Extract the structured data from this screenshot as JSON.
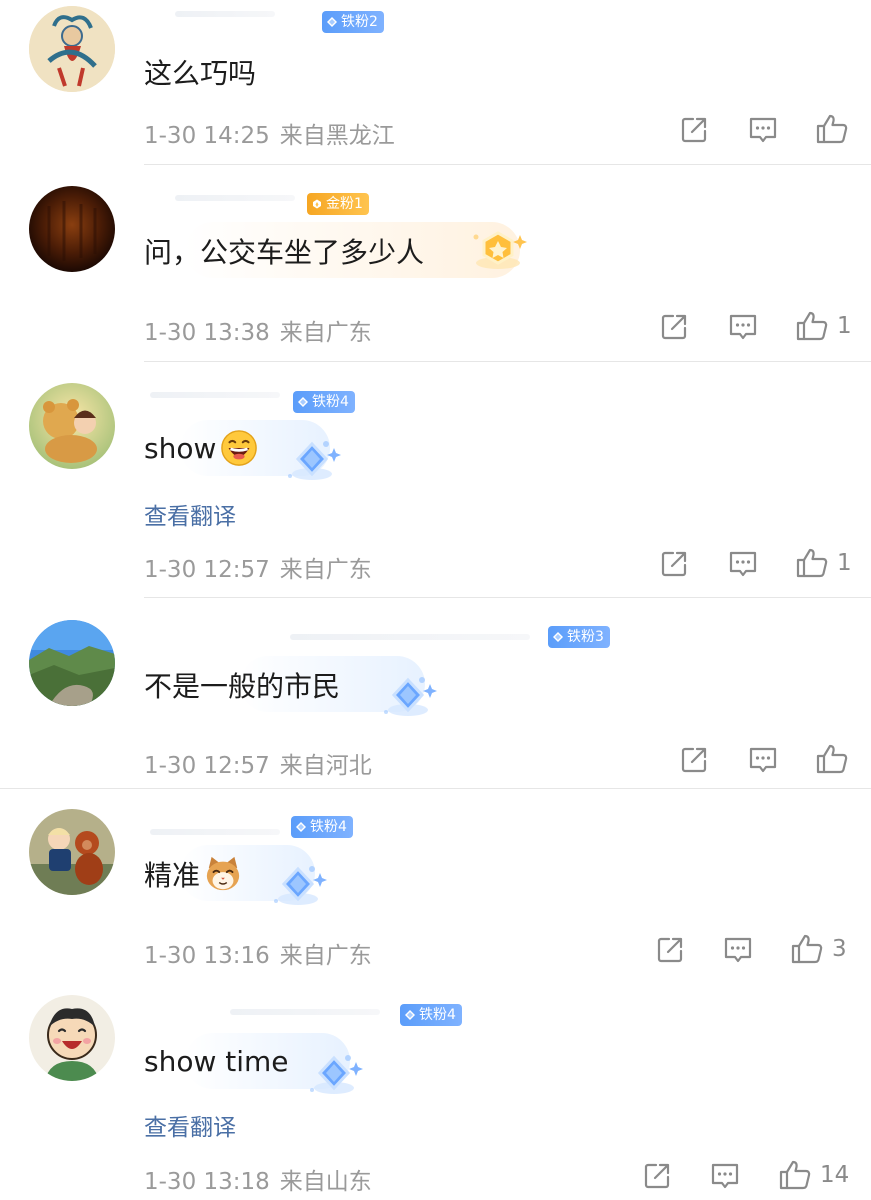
{
  "comments": [
    {
      "badge": "铁粉2",
      "badge_type": "iron",
      "text": "这么巧吗",
      "date": "1-30 14:25",
      "location": "来自黑龙江",
      "likes": ""
    },
    {
      "badge": "金粉1",
      "badge_type": "gold",
      "text": "问，公交车坐了多少人",
      "date": "1-30 13:38",
      "location": "来自广东",
      "likes": "1"
    },
    {
      "badge": "铁粉4",
      "badge_type": "iron",
      "text": "show",
      "emoji": "laughing-face",
      "translate": "查看翻译",
      "date": "1-30 12:57",
      "location": "来自广东",
      "likes": "1"
    },
    {
      "badge": "铁粉3",
      "badge_type": "iron",
      "text": "不是一般的市民",
      "date": "1-30 12:57",
      "location": "来自河北",
      "likes": ""
    },
    {
      "badge": "铁粉4",
      "badge_type": "iron",
      "text": "精准",
      "emoji": "cat-face",
      "date": "1-30 13:16",
      "location": "来自广东",
      "likes": "3"
    },
    {
      "badge": "铁粉4",
      "badge_type": "iron",
      "text": "show time",
      "translate": "查看翻译",
      "date": "1-30 13:18",
      "location": "来自山东",
      "likes": "14"
    }
  ],
  "icons": {
    "repost": "repost-icon",
    "comment": "comment-icon",
    "like": "thumbs-up-icon"
  },
  "colors": {
    "text": "#1c1c1c",
    "meta": "#9a9a9a",
    "link": "#4a6fa5",
    "iron_badge": "#5b9dfa",
    "gold_badge": "#f6a623",
    "divider": "#e6e6e6"
  }
}
